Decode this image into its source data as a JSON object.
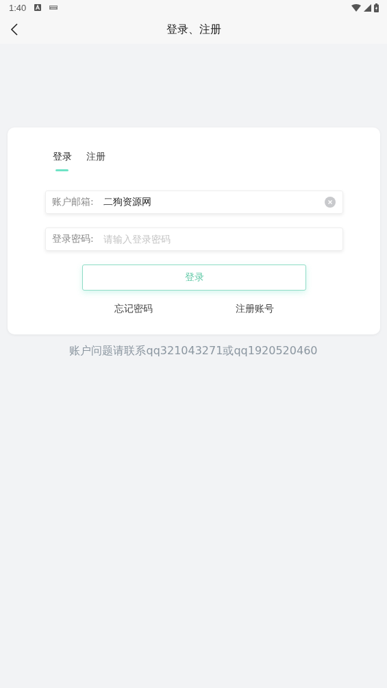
{
  "status_bar": {
    "time": "1:40"
  },
  "nav": {
    "title": "登录、注册"
  },
  "tabs": [
    {
      "label": "登录",
      "selected": true
    },
    {
      "label": "注册",
      "selected": false
    }
  ],
  "fields": [
    {
      "label": "账户邮箱:",
      "value": "二狗资源网",
      "clearable": true
    },
    {
      "label": "登录密码:",
      "placeholder": "请输入登录密码",
      "clearable": false
    }
  ],
  "login_button": "登录",
  "links": [
    "忘记密码",
    "注册账号"
  ],
  "footer": "账户问题请联系qq321043271或qq1920520460"
}
